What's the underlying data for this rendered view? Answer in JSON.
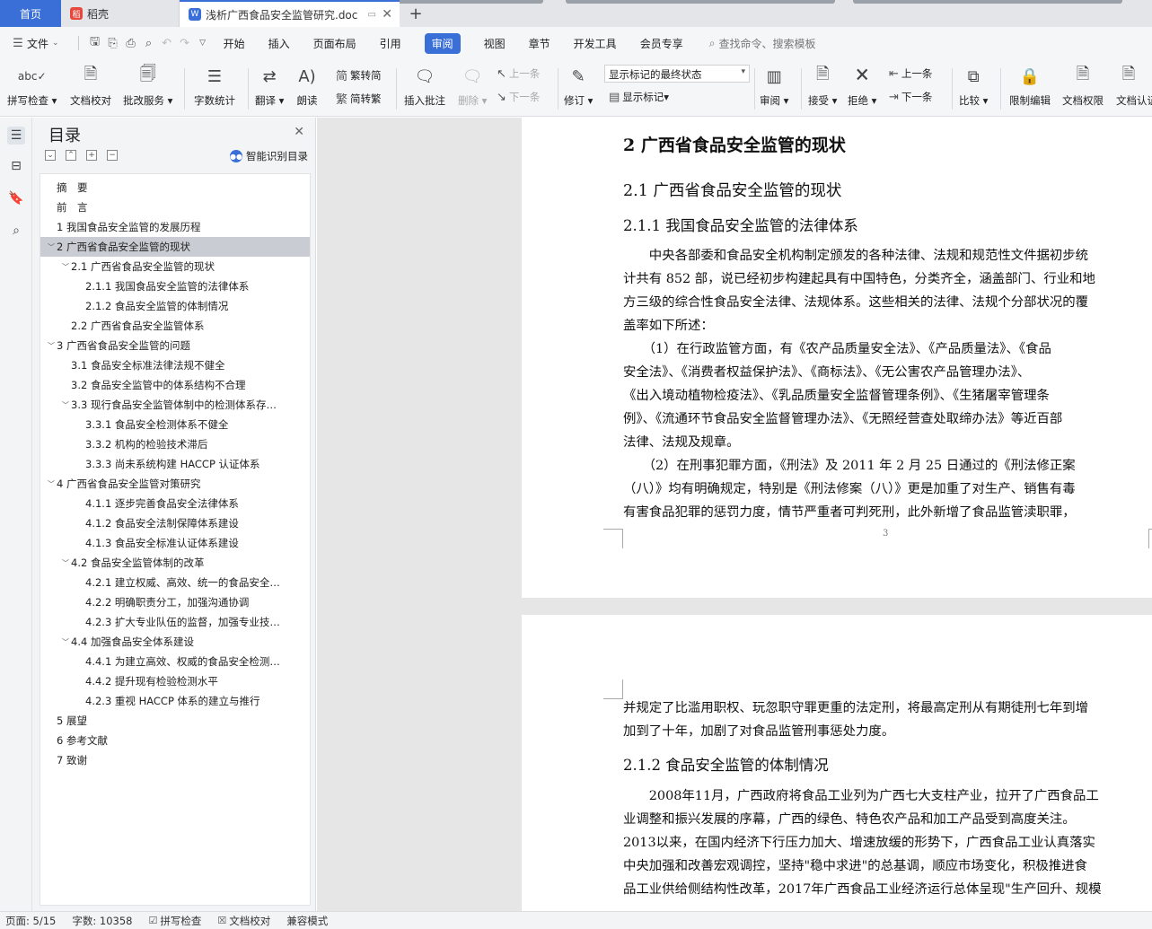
{
  "tabs": {
    "home": "首页",
    "daoke": "稻壳",
    "doc": "浅析广西食品安全监管研究.doc",
    "add": "+"
  },
  "menu": {
    "file": "文件",
    "items": [
      "开始",
      "插入",
      "页面布局",
      "引用",
      "审阅",
      "视图",
      "章节",
      "开发工具",
      "会员专享"
    ],
    "search": "查找命令、搜索模板"
  },
  "ribbon": {
    "spell": "拼写检查",
    "proof": "文档校对",
    "annotate_service": "批改服务",
    "wordcount": "字数统计",
    "translate": "翻译",
    "read": "朗读",
    "to_trad": "繁转简",
    "to_simp": "简转繁",
    "insert_comment": "插入批注",
    "delete": "删除",
    "prev": "上一条",
    "next": "下一条",
    "track": "修订",
    "display_combo": "显示标记的最终状态",
    "show_marks": "显示标记",
    "review": "审阅",
    "accept": "接受",
    "reject": "拒绝",
    "prev2": "上一条",
    "next2": "下一条",
    "compare": "比较",
    "restrict": "限制编辑",
    "permission": "文档权限",
    "doc_cert": "文档认证"
  },
  "toc": {
    "title": "目录",
    "smart": "智能识别目录",
    "items": [
      {
        "text": "摘　要",
        "level": 0,
        "caret": ""
      },
      {
        "text": "前　言",
        "level": 0,
        "caret": ""
      },
      {
        "text": "1 我国食品安全监管的发展历程",
        "level": 0,
        "caret": ""
      },
      {
        "text": "2 广西省食品安全监管的现状",
        "level": 0,
        "caret": "v",
        "sel": true
      },
      {
        "text": "2.1 广西省食品安全监管的现状",
        "level": 1,
        "caret": "v"
      },
      {
        "text": "2.1.1 我国食品安全监管的法律体系",
        "level": 2,
        "caret": ""
      },
      {
        "text": "2.1.2 食品安全监管的体制情况",
        "level": 2,
        "caret": ""
      },
      {
        "text": "2.2 广西省食品安全监管体系",
        "level": 1,
        "caret": ""
      },
      {
        "text": "3 广西省食品安全监管的问题",
        "level": 0,
        "caret": "v"
      },
      {
        "text": "3.1 食品安全标准法律法规不健全",
        "level": 1,
        "caret": ""
      },
      {
        "text": "3.2 食品安全监管中的体系结构不合理",
        "level": 1,
        "caret": ""
      },
      {
        "text": "3.3 现行食品安全监管体制中的检测体系存…",
        "level": 1,
        "caret": "v"
      },
      {
        "text": "3.3.1 食品安全检测体系不健全",
        "level": 2,
        "caret": ""
      },
      {
        "text": "3.3.2 机构的检验技术滞后",
        "level": 2,
        "caret": ""
      },
      {
        "text": "3.3.3 尚未系统构建 HACCP 认证体系",
        "level": 2,
        "caret": ""
      },
      {
        "text": "4 广西省食品安全监管对策研究",
        "level": 0,
        "caret": "v"
      },
      {
        "text": "4.1.1 逐步完善食品安全法律体系",
        "level": 2,
        "caret": ""
      },
      {
        "text": "4.1.2 食品安全法制保障体系建设",
        "level": 2,
        "caret": ""
      },
      {
        "text": "4.1.3 食品安全标准认证体系建设",
        "level": 2,
        "caret": ""
      },
      {
        "text": "4.2 食品安全监管体制的改革",
        "level": 1,
        "caret": "v"
      },
      {
        "text": "4.2.1 建立权威、高效、统一的食品安全…",
        "level": 2,
        "caret": ""
      },
      {
        "text": "4.2.2 明确职责分工，加强沟通协调",
        "level": 2,
        "caret": ""
      },
      {
        "text": "4.2.3 扩大专业队伍的监督，加强专业技…",
        "level": 2,
        "caret": ""
      },
      {
        "text": "4.4 加强食品安全体系建设",
        "level": 1,
        "caret": "v"
      },
      {
        "text": "4.4.1 为建立高效、权威的食品安全检测…",
        "level": 2,
        "caret": ""
      },
      {
        "text": "4.4.2 提升现有检验检测水平",
        "level": 2,
        "caret": ""
      },
      {
        "text": "4.2.3 重视 HACCP 体系的建立与推行",
        "level": 2,
        "caret": ""
      },
      {
        "text": "5 展望",
        "level": 0,
        "caret": ""
      },
      {
        "text": "6 参考文献",
        "level": 0,
        "caret": ""
      },
      {
        "text": "7 致谢",
        "level": 0,
        "caret": ""
      }
    ]
  },
  "document": {
    "h1": "2 广西省食品安全监管的现状",
    "h2": "2.1 广西省食品安全监管的现状",
    "h3a": "2.1.1 我国食品安全监管的法律体系",
    "p1": [
      "　　中央各部委和食品安全机构制定颁发的各种法律、法规和规范性文件据初步统",
      "计共有 852 部，说已经初步构建起具有中国特色，分类齐全，涵盖部门、行业和地",
      "方三级的综合性食品安全法律、法规体系。这些相关的法律、法规个分部状况的覆",
      "盖率如下所述："
    ],
    "p2": [
      "　　（1）在行政监管方面，有《农产品质量安全法》、《产品质量法》、《食品",
      "安全法》、《消费者权益保护法》、《商标法》、《无公害农产品管理办法》、",
      "《出入境动植物检疫法》、《乳品质量安全监督管理条例》、《生猪屠宰管理条",
      "例》、《流通环节食品安全监督管理办法》、《无照经营查处取缔办法》等近百部",
      "法律、法规及规章。"
    ],
    "p3": [
      "　　（2）在刑事犯罪方面，《刑法》及 2011 年 2 月 25 日通过的《刑法修正案",
      "（八）》均有明确规定，特别是《刑法修案（八）》更是加重了对生产、销售有毒",
      "有害食品犯罪的惩罚力度，情节严重者可判死刑，此外新增了食品监管渎职罪，"
    ],
    "page_number": "3",
    "p4": [
      "并规定了比滥用职权、玩忽职守罪更重的法定刑，将最高定刑从有期徒刑七年到增",
      "加到了十年，加剧了对食品监管刑事惩处力度。"
    ],
    "h3b": "2.1.2 食品安全监管的体制情况",
    "p5": [
      "　　2008年11月，广西政府将食品工业列为广西七大支柱产业，拉开了广西食品工",
      "业调整和振兴发展的序幕，广西的绿色、特色农产品和加工产品受到高度关注。",
      "2013以来，在国内经济下行压力加大、增速放缓的形势下，广西食品工业认真落实",
      "中央加强和改善宏观调控，坚持\"稳中求进\"的总基调，顺应市场变化，积极推进食",
      "品工业供给侧结构性改革，2017年广西食品工业经济运行总体呈现\"生产回升、规模"
    ]
  },
  "status": {
    "page": "页面: 5/15",
    "words": "字数: 10358",
    "spell": "拼写检查",
    "proof": "文档校对",
    "compat": "兼容模式"
  }
}
